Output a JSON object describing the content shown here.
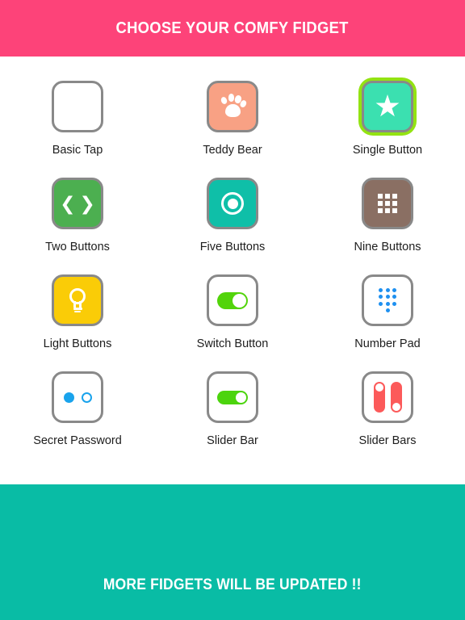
{
  "header": {
    "title": "CHOOSE YOUR COMFY FIDGET",
    "background_color": "#FD4379",
    "text_color": "#FFFFFF"
  },
  "footer": {
    "message": "MORE FIDGETS WILL BE UPDATED !!",
    "background_color": "#09BCA5",
    "text_color": "#FFFFFF"
  },
  "grid": {
    "columns": 3,
    "rows": 4,
    "selected_index": 2,
    "selection_color": "#93E312",
    "tile_border_color": "#898989",
    "label_color": "#1D1D1D",
    "items": [
      {
        "label": "Basic Tap",
        "icon": "blank-tile-icon",
        "tile_color": "#FFFFFF",
        "icon_color": "#FFFFFF",
        "selected": false
      },
      {
        "label": "Teddy Bear",
        "icon": "paw-print-icon",
        "tile_color": "#F8A184",
        "icon_color": "#FFFFFF",
        "selected": false
      },
      {
        "label": "Single Button",
        "icon": "star-icon",
        "tile_color": "#3BE0B0",
        "icon_color": "#FFFFFF",
        "selected": true
      },
      {
        "label": "Two Buttons",
        "icon": "chevron-left-right-icon",
        "tile_color": "#4CAF50",
        "icon_color": "#FFFFFF",
        "selected": false
      },
      {
        "label": "Five Buttons",
        "icon": "circle-target-icon",
        "tile_color": "#0FBFA8",
        "icon_color": "#FFFFFF",
        "selected": false
      },
      {
        "label": "Nine Buttons",
        "icon": "grid-nine-icon",
        "tile_color": "#8A6F63",
        "icon_color": "#FFFFFF",
        "selected": false
      },
      {
        "label": "Light Buttons",
        "icon": "lightbulb-icon",
        "tile_color": "#FACC07",
        "icon_color": "#FFFFFF",
        "selected": false
      },
      {
        "label": "Switch Button",
        "icon": "toggle-switch-icon",
        "tile_color": "#FFFFFF",
        "icon_color": "#52D40A",
        "selected": false
      },
      {
        "label": "Number Pad",
        "icon": "number-pad-dots-icon",
        "tile_color": "#FFFFFF",
        "icon_color": "#1E90F0",
        "selected": false
      },
      {
        "label": "Secret Password",
        "icon": "password-dots-icon",
        "tile_color": "#FFFFFF",
        "icon_color": "#19A3EC",
        "selected": false
      },
      {
        "label": "Slider Bar",
        "icon": "horizontal-slider-icon",
        "tile_color": "#FFFFFF",
        "icon_color": "#4CD40E",
        "selected": false
      },
      {
        "label": "Slider Bars",
        "icon": "vertical-sliders-icon",
        "tile_color": "#FFFFFF",
        "icon_color": "#FC5A5A",
        "selected": false
      }
    ]
  }
}
